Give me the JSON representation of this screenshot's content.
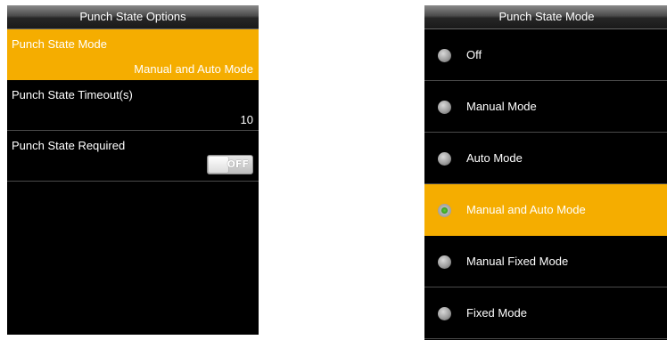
{
  "left_screen": {
    "title": "Punch State Options",
    "options": [
      {
        "label": "Punch State Mode",
        "value": "Manual and Auto Mode",
        "selected": true
      },
      {
        "label": "Punch State Timeout(s)",
        "value": "10",
        "selected": false
      },
      {
        "label": "Punch State Required",
        "toggle": "OFF",
        "selected": false
      }
    ]
  },
  "right_screen": {
    "title": "Punch State Mode",
    "modes": [
      {
        "label": "Off",
        "checked": false
      },
      {
        "label": "Manual Mode",
        "checked": false
      },
      {
        "label": "Auto Mode",
        "checked": false
      },
      {
        "label": "Manual and Auto Mode",
        "checked": true
      },
      {
        "label": "Manual Fixed Mode",
        "checked": false
      },
      {
        "label": "Fixed Mode",
        "checked": false
      }
    ]
  },
  "colors": {
    "highlight": "#f5ad00",
    "screen_bg": "#000000",
    "radio_checked": "#3a9f22"
  }
}
